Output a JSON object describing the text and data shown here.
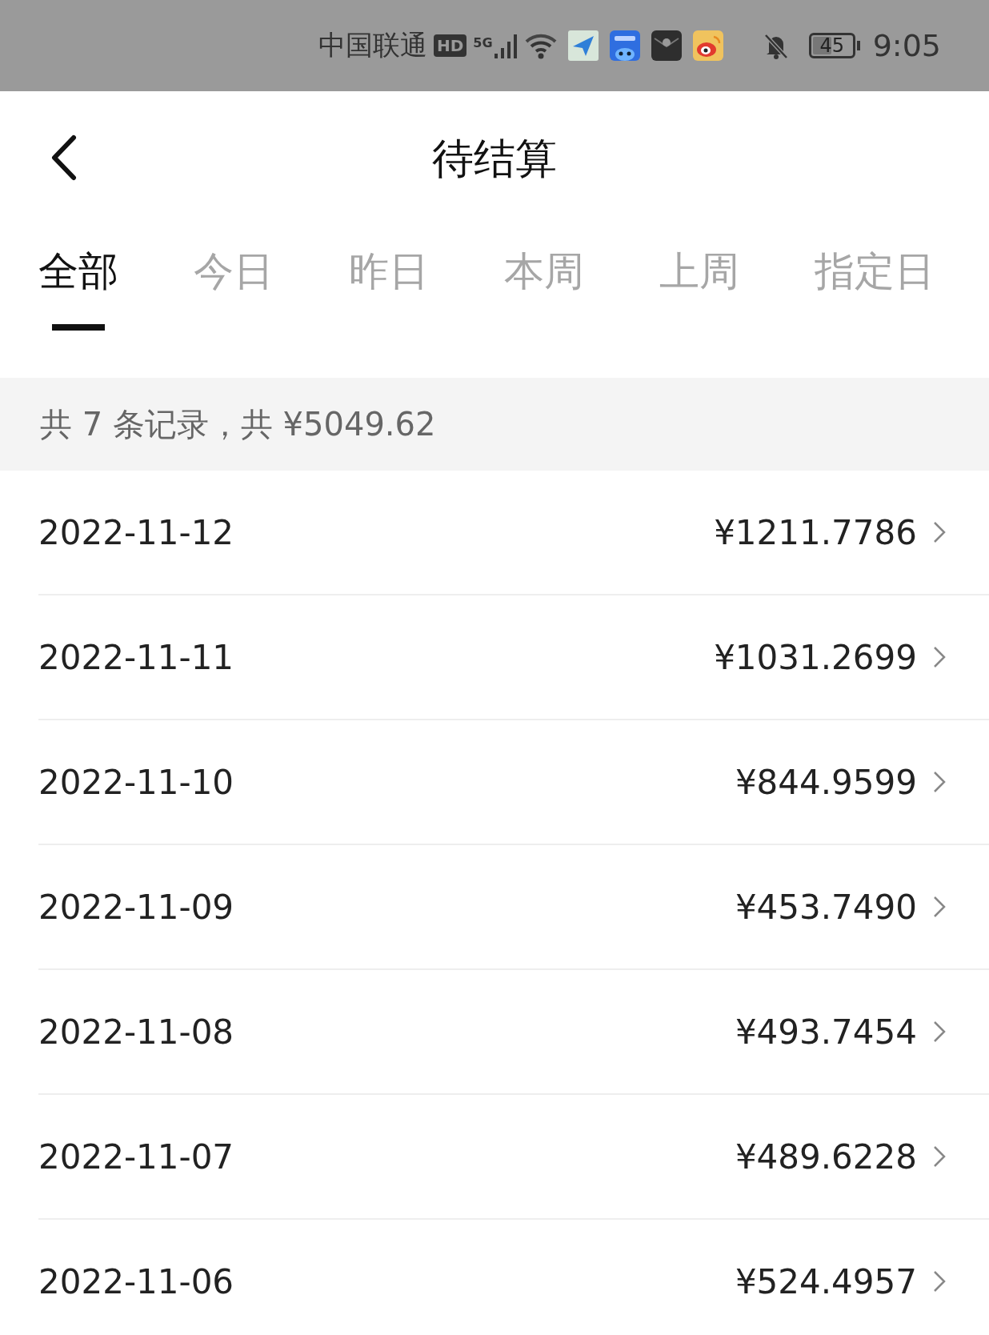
{
  "status_bar": {
    "carrier": "中国联通",
    "hd": "HD",
    "network": "5G",
    "battery": "45",
    "time": "9:05"
  },
  "header": {
    "title": "待结算"
  },
  "tabs": [
    {
      "label": "全部",
      "selected": true
    },
    {
      "label": "今日",
      "selected": false
    },
    {
      "label": "昨日",
      "selected": false
    },
    {
      "label": "本周",
      "selected": false
    },
    {
      "label": "上周",
      "selected": false
    },
    {
      "label": "指定日",
      "selected": false
    }
  ],
  "summary": "共 7 条记录，共 ¥5049.62",
  "records": [
    {
      "date": "2022-11-12",
      "amount": "¥1211.7786"
    },
    {
      "date": "2022-11-11",
      "amount": "¥1031.2699"
    },
    {
      "date": "2022-11-10",
      "amount": "¥844.9599"
    },
    {
      "date": "2022-11-09",
      "amount": "¥453.7490"
    },
    {
      "date": "2022-11-08",
      "amount": "¥493.7454"
    },
    {
      "date": "2022-11-07",
      "amount": "¥489.6228"
    },
    {
      "date": "2022-11-06",
      "amount": "¥524.4957"
    }
  ]
}
